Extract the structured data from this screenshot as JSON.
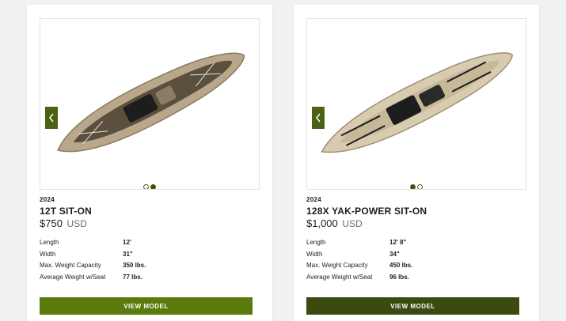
{
  "colors": {
    "accent": "#4b6212",
    "button_1": "#5a7a0c",
    "button_2": "#3b4a10",
    "background": "#f0f1f3"
  },
  "cards": [
    {
      "year": "2024",
      "model": "12T SIT-ON",
      "price": "$750",
      "currency": "USD",
      "specs": [
        {
          "label": "Length",
          "value": "12'"
        },
        {
          "label": "Width",
          "value": "31\""
        },
        {
          "label": "Max. Weight Capacity",
          "value": "350 lbs."
        },
        {
          "label": "Average Weight w/Seat",
          "value": "77 lbs."
        }
      ],
      "button_label": "VIEW MODEL",
      "carousel": {
        "slides": 2,
        "active": 2
      },
      "icons": {
        "prev": "chevron-left-icon",
        "next": "chevron-right-icon"
      }
    },
    {
      "year": "2024",
      "model": "128X YAK-POWER SIT-ON",
      "price": "$1,000",
      "currency": "USD",
      "specs": [
        {
          "label": "Length",
          "value": "12' 8\""
        },
        {
          "label": "Width",
          "value": "34\""
        },
        {
          "label": "Max. Weight Capacity",
          "value": "450 lbs."
        },
        {
          "label": "Average Weight w/Seat",
          "value": "96 lbs."
        }
      ],
      "button_label": "VIEW MODEL",
      "carousel": {
        "slides": 2,
        "active": 1
      },
      "icons": {
        "prev": "chevron-left-icon",
        "next": "chevron-right-icon"
      }
    }
  ]
}
